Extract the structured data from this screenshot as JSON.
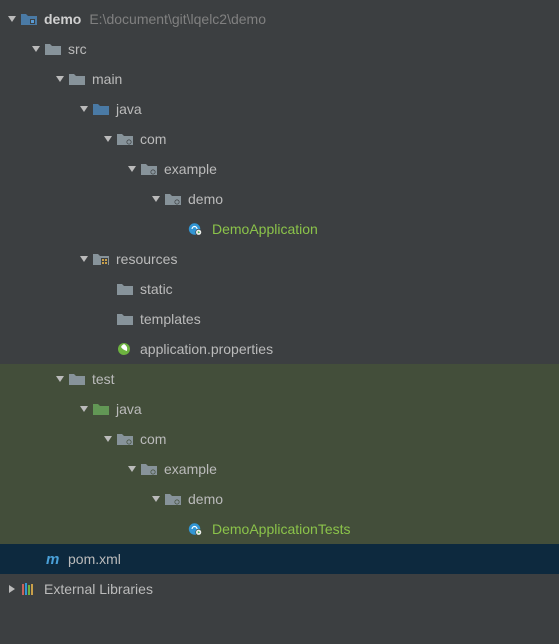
{
  "root": {
    "name": "demo",
    "path": "E:\\document\\git\\lqelc2\\demo"
  },
  "src": {
    "label": "src"
  },
  "main": {
    "label": "main"
  },
  "main_java": {
    "label": "java"
  },
  "main_com": {
    "label": "com"
  },
  "main_example": {
    "label": "example"
  },
  "main_demo": {
    "label": "demo"
  },
  "demo_app": {
    "label": "DemoApplication"
  },
  "resources": {
    "label": "resources"
  },
  "static": {
    "label": "static"
  },
  "templates": {
    "label": "templates"
  },
  "app_props": {
    "label": "application.properties"
  },
  "test": {
    "label": "test"
  },
  "test_java": {
    "label": "java"
  },
  "test_com": {
    "label": "com"
  },
  "test_example": {
    "label": "example"
  },
  "test_demo": {
    "label": "demo"
  },
  "demo_app_tests": {
    "label": "DemoApplicationTests"
  },
  "pom": {
    "label": "pom.xml"
  },
  "ext_libs": {
    "label": "External Libraries"
  }
}
